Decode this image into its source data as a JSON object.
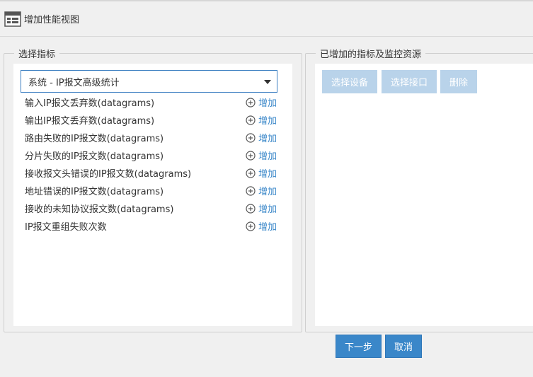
{
  "header": {
    "title": "增加性能视图",
    "icon": "window-list-icon"
  },
  "left_group": {
    "legend": "选择指标",
    "select": {
      "value": "系统 - IP报文高级统计"
    },
    "metrics": [
      {
        "label": "输入IP报文丢弃数(datagrams)",
        "action": "增加"
      },
      {
        "label": "输出IP报文丢弃数(datagrams)",
        "action": "增加"
      },
      {
        "label": "路由失败的IP报文数(datagrams)",
        "action": "增加"
      },
      {
        "label": "分片失败的IP报文数(datagrams)",
        "action": "增加"
      },
      {
        "label": "接收报文头错误的IP报文数(datagrams)",
        "action": "增加"
      },
      {
        "label": "地址错误的IP报文数(datagrams)",
        "action": "增加"
      },
      {
        "label": "接收的未知协议报文数(datagrams)",
        "action": "增加"
      },
      {
        "label": "IP报文重组失败次数",
        "action": "增加"
      }
    ]
  },
  "right_group": {
    "legend": "已增加的指标及监控资源",
    "buttons": {
      "select_device": "选择设备",
      "select_interface": "选择接口",
      "delete": "删除"
    }
  },
  "footer": {
    "next": "下一步",
    "cancel": "取消"
  },
  "colors": {
    "primary": "#3a87c9",
    "disabled": "#b9d3ea",
    "border": "#cfcfcf",
    "background": "#f0f0f0"
  }
}
